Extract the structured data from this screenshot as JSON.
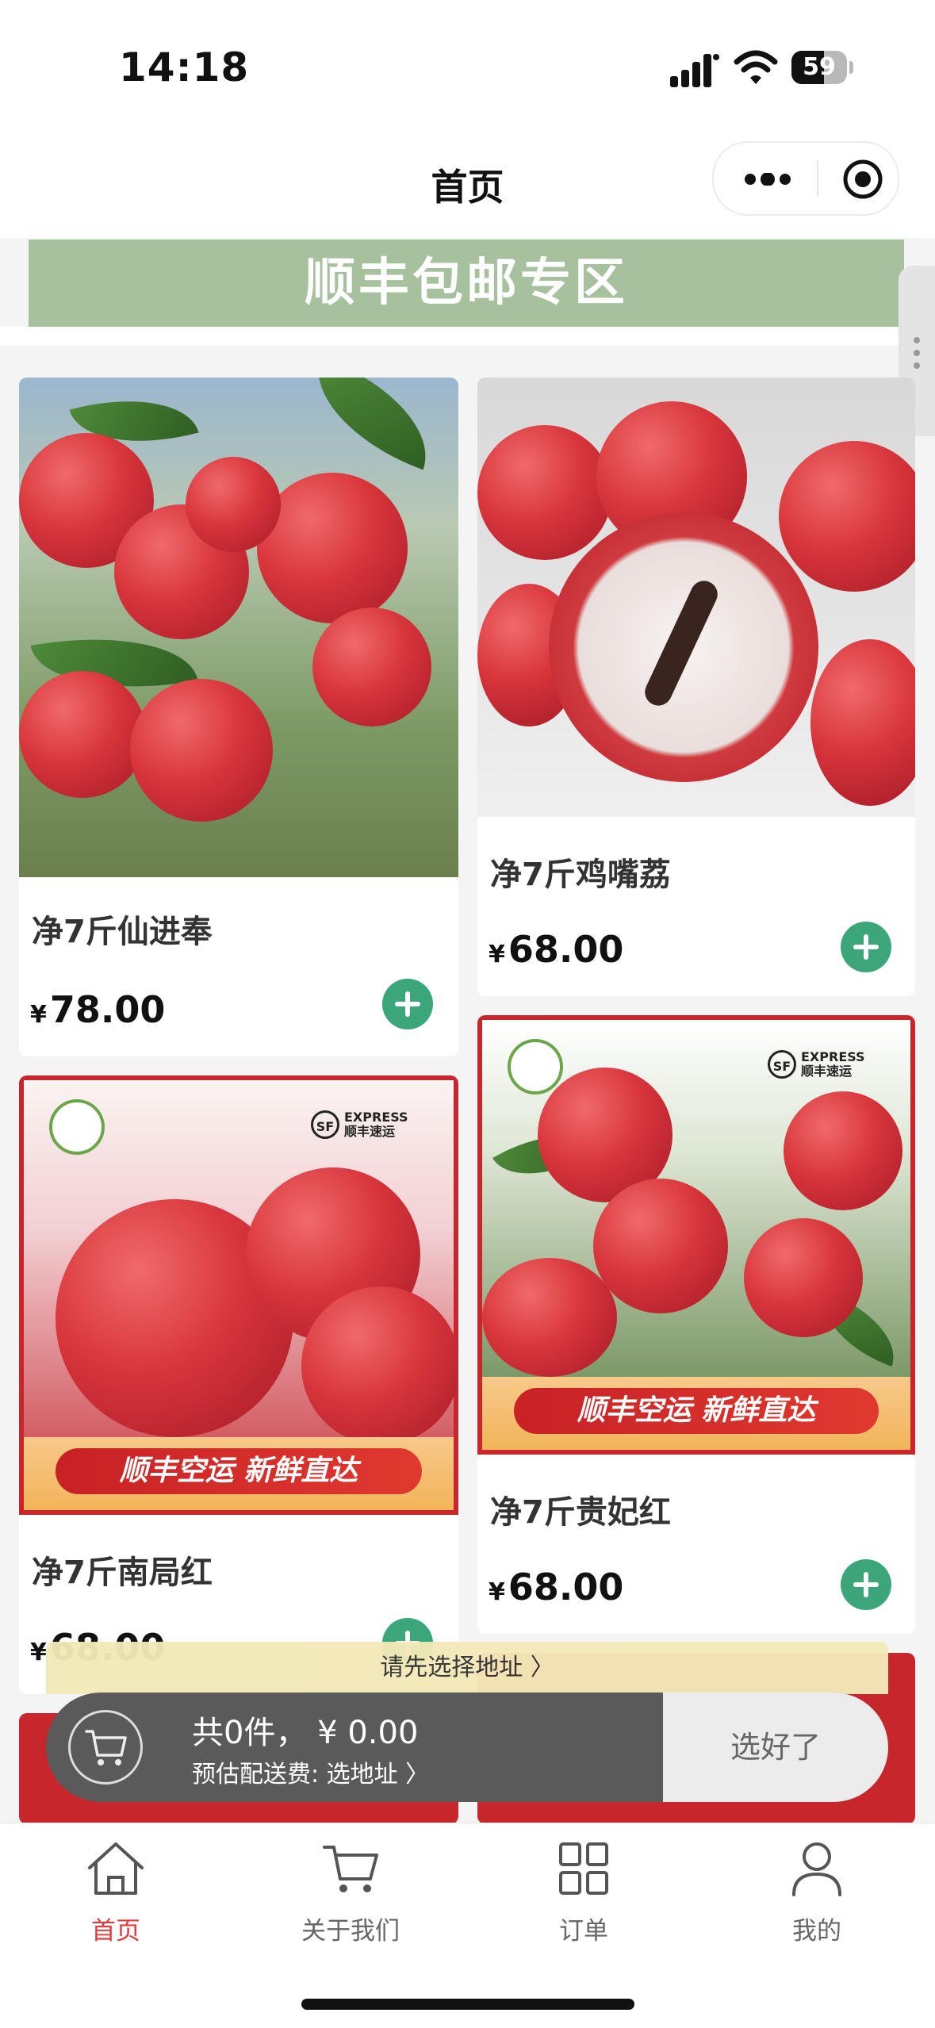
{
  "status_bar": {
    "time": "14:18",
    "battery": "59",
    "battery_level": 0.59
  },
  "nav": {
    "title": "首页"
  },
  "banner": {
    "text": "顺丰包邮专区"
  },
  "products": [
    {
      "name": "净7斤仙进奉",
      "currency": "¥",
      "price": "78.00"
    },
    {
      "name": "净7斤鸡嘴荔",
      "currency": "¥",
      "price": "68.00"
    },
    {
      "name": "净7斤南局红",
      "currency": "¥",
      "price": "68.00",
      "promo": "顺丰空运  新鲜直达",
      "sf_cn": "顺丰速运",
      "sf_en": "EXPRESS"
    },
    {
      "name": "净7斤贵妃红",
      "currency": "¥",
      "price": "68.00",
      "promo": "顺丰空运  新鲜直达",
      "sf_cn": "顺丰速运",
      "sf_en": "EXPRESS"
    }
  ],
  "address_bar": {
    "text": "请先选择地址 〉"
  },
  "cart": {
    "summary": "共0件，  ¥ 0.00",
    "fee": "预估配送费: 选地址 〉",
    "done": "选好了"
  },
  "tabbar": {
    "items": [
      {
        "label": "首页",
        "icon": "home-icon",
        "active": true
      },
      {
        "label": "关于我们",
        "icon": "cart-icon",
        "active": false
      },
      {
        "label": "订单",
        "icon": "grid-icon",
        "active": false
      },
      {
        "label": "我的",
        "icon": "user-icon",
        "active": false
      }
    ]
  },
  "colors": {
    "accent": "#e4393c",
    "add_button": "#3aa67a",
    "banner": "#a7c09d",
    "cart_bar": "#5a5a5a"
  }
}
